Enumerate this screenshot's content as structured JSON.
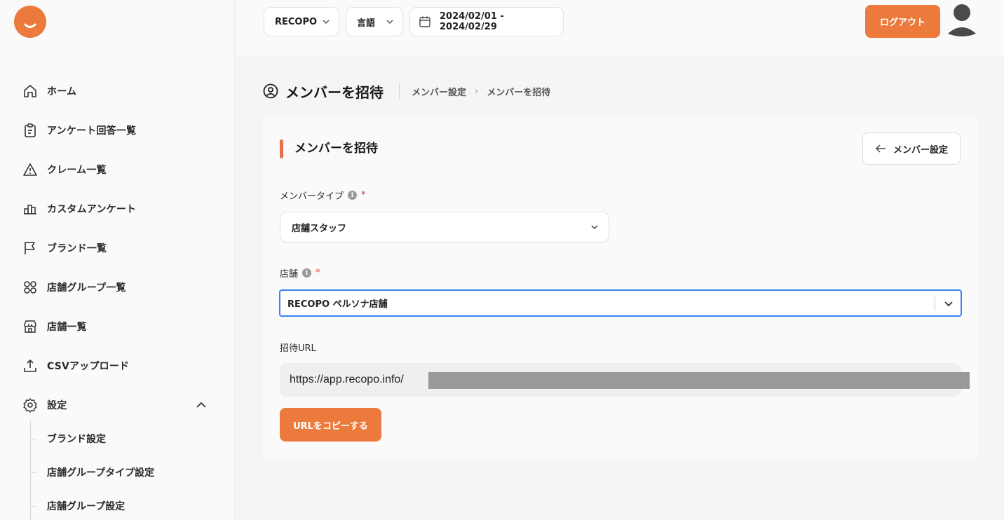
{
  "topbar": {
    "brand_select": "RECOPO",
    "language_select": "言語",
    "date_range": "2024/02/01 - 2024/02/29",
    "logout_label": "ログアウト"
  },
  "sidebar": {
    "items": [
      {
        "label": "ホーム",
        "icon": "home-icon"
      },
      {
        "label": "アンケート回答一覧",
        "icon": "clipboard-icon"
      },
      {
        "label": "クレーム一覧",
        "icon": "warning-icon"
      },
      {
        "label": "カスタムアンケート",
        "icon": "chart-icon"
      },
      {
        "label": "ブランド一覧",
        "icon": "flag-icon"
      },
      {
        "label": "店舗グループ一覧",
        "icon": "grid-icon"
      },
      {
        "label": "店舗一覧",
        "icon": "store-icon"
      },
      {
        "label": "CSVアップロード",
        "icon": "upload-icon"
      },
      {
        "label": "設定",
        "icon": "gear-icon"
      }
    ],
    "sub_items": [
      {
        "label": "ブランド設定"
      },
      {
        "label": "店舗グループタイプ設定"
      },
      {
        "label": "店舗グループ設定"
      }
    ]
  },
  "page": {
    "title": "メンバーを招待",
    "breadcrumb": [
      "メンバー設定",
      "メンバーを招待"
    ]
  },
  "card": {
    "title": "メンバーを招待",
    "back_button": "メンバー設定",
    "member_type_label": "メンバータイプ",
    "member_type_value": "店舗スタッフ",
    "store_label": "店舗",
    "store_value": "RECOPO ペルソナ店舗",
    "invite_url_label": "招待URL",
    "invite_url_value": "https://app.recopo.info/",
    "copy_button": "URLをコピーする",
    "required_mark": "*",
    "info_mark": "i"
  },
  "colors": {
    "accent": "#ec7a3c",
    "focus": "#3b82f6",
    "required": "#e53935"
  }
}
